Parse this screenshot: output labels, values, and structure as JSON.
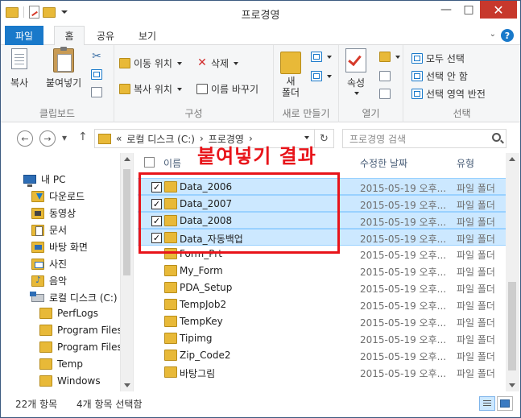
{
  "window": {
    "title": "프로경영",
    "controls": {
      "minimize": "—",
      "maximize": "□",
      "close": "✕"
    }
  },
  "ribbon": {
    "tabs": [
      "파일",
      "홈",
      "공유",
      "보기"
    ],
    "active_tab": "홈",
    "help": "?",
    "groups": {
      "clipboard": {
        "label": "클립보드",
        "copy": "복사",
        "paste": "붙여넣기"
      },
      "organize": {
        "label": "구성",
        "move_to": "이동 위치",
        "copy_to": "복사 위치",
        "delete": "삭제",
        "rename": "이름 바꾸기"
      },
      "new": {
        "label": "새로 만들기",
        "new_folder_line1": "새",
        "new_folder_line2": "폴더"
      },
      "open": {
        "label": "열기",
        "properties": "속성"
      },
      "select": {
        "label": "선택",
        "select_all": "모두 선택",
        "select_none": "선택 안 함",
        "invert": "선택 영역 반전"
      }
    }
  },
  "address": {
    "prefix": "«",
    "crumbs": [
      "로컬 디스크 (C:)",
      "프로경영"
    ],
    "separator": "›",
    "search_placeholder": "프로경영 검색"
  },
  "nav": {
    "items": [
      {
        "label": "내 PC",
        "icon": "pc-icon"
      },
      {
        "label": "다운로드",
        "icon": "download-folder-icon"
      },
      {
        "label": "동영상",
        "icon": "video-folder-icon"
      },
      {
        "label": "문서",
        "icon": "documents-folder-icon"
      },
      {
        "label": "바탕 화면",
        "icon": "desktop-folder-icon"
      },
      {
        "label": "사진",
        "icon": "pictures-folder-icon"
      },
      {
        "label": "음악",
        "icon": "music-folder-icon"
      },
      {
        "label": "로컬 디스크 (C:)",
        "icon": "drive-icon"
      },
      {
        "label": "PerfLogs",
        "icon": "folder-icon"
      },
      {
        "label": "Program Files",
        "icon": "folder-icon"
      },
      {
        "label": "Program Files (",
        "icon": "folder-icon"
      },
      {
        "label": "Temp",
        "icon": "folder-icon"
      },
      {
        "label": "Windows",
        "icon": "folder-icon"
      }
    ]
  },
  "list": {
    "columns": {
      "name": "이름",
      "date": "수정한 날짜",
      "type": "유형"
    },
    "rows": [
      {
        "name": "Data_2006",
        "date": "2015-05-19 오후...",
        "type": "파일 폴더",
        "selected": true
      },
      {
        "name": "Data_2007",
        "date": "2015-05-19 오후...",
        "type": "파일 폴더",
        "selected": true
      },
      {
        "name": "Data_2008",
        "date": "2015-05-19 오후...",
        "type": "파일 폴더",
        "selected": true
      },
      {
        "name": "Data_자동백업",
        "date": "2015-05-19 오후...",
        "type": "파일 폴더",
        "selected": true
      },
      {
        "name": "Form_Prt",
        "date": "2015-05-19 오후...",
        "type": "파일 폴더",
        "selected": false
      },
      {
        "name": "My_Form",
        "date": "2015-05-19 오후...",
        "type": "파일 폴더",
        "selected": false
      },
      {
        "name": "PDA_Setup",
        "date": "2015-05-19 오후...",
        "type": "파일 폴더",
        "selected": false
      },
      {
        "name": "TempJob2",
        "date": "2015-05-19 오후...",
        "type": "파일 폴더",
        "selected": false
      },
      {
        "name": "TempKey",
        "date": "2015-05-19 오후...",
        "type": "파일 폴더",
        "selected": false
      },
      {
        "name": "Tipimg",
        "date": "2015-05-19 오후...",
        "type": "파일 폴더",
        "selected": false
      },
      {
        "name": "Zip_Code2",
        "date": "2015-05-19 오후...",
        "type": "파일 폴더",
        "selected": false
      },
      {
        "name": "바탕그림",
        "date": "2015-05-19 오후...",
        "type": "파일 폴더",
        "selected": false
      }
    ],
    "check_mark": "✓"
  },
  "annotation": {
    "text": "붙여넣기 결과",
    "color": "#e8141a"
  },
  "status": {
    "item_count": "22개 항목",
    "selected_count": "4개 항목 선택함"
  },
  "colors": {
    "accent": "#1979ca",
    "selection": "#cce8ff",
    "folder": "#e8b938"
  }
}
